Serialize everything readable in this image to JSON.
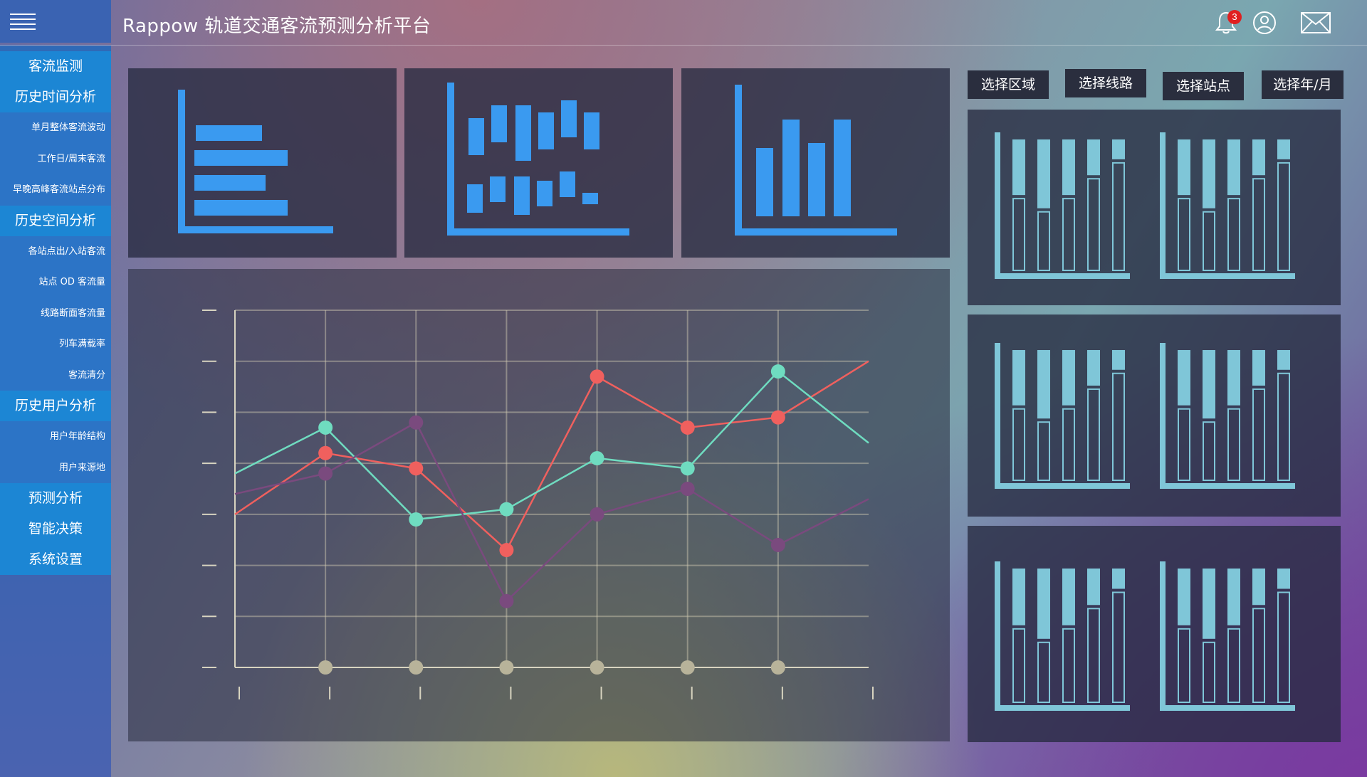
{
  "app": {
    "title": "Rappow 轨道交通客流预测分析平台",
    "notification_count": "3"
  },
  "icons": {
    "menu": "hamburger-menu-icon",
    "bell": "bell-icon",
    "user": "user-icon",
    "mail": "mail-icon"
  },
  "sidebar": {
    "items": [
      {
        "label": "客流监测",
        "level": "main"
      },
      {
        "label": "历史时间分析",
        "level": "main"
      },
      {
        "label": "单月整体客流波动",
        "level": "sub"
      },
      {
        "label": "工作日/周末客流",
        "level": "sub"
      },
      {
        "label": "早晚高峰客流站点分布",
        "level": "sub"
      },
      {
        "label": "历史空间分析",
        "level": "main"
      },
      {
        "label": "各站点出/入站客流",
        "level": "sub"
      },
      {
        "label": "站点 OD 客流量",
        "level": "sub"
      },
      {
        "label": "线路断面客流量",
        "level": "sub"
      },
      {
        "label": "列车满载率",
        "level": "sub"
      },
      {
        "label": "客流清分",
        "level": "sub"
      },
      {
        "label": "历史用户分析",
        "level": "main"
      },
      {
        "label": "用户年龄结构",
        "level": "sub"
      },
      {
        "label": "用户来源地",
        "level": "sub"
      },
      {
        "label": "预测分析",
        "level": "main"
      },
      {
        "label": "智能决策",
        "level": "main"
      },
      {
        "label": "系统设置",
        "level": "main"
      }
    ]
  },
  "filters": {
    "region": "选择区域",
    "line": "选择线路",
    "station": "选择站点",
    "year_month": "选择年/月"
  },
  "colors": {
    "accent_blue": "#3a9af0",
    "side_bar": "#7fc6d8",
    "series_red": "#f0605e",
    "series_teal": "#6fdcc0",
    "series_purple": "#7a4a7e",
    "axis_dot": "#b8b39a"
  },
  "chart_data": {
    "type": "line",
    "x": [
      0,
      1,
      2,
      3,
      4,
      5,
      6,
      7
    ],
    "ylim": [
      0,
      7
    ],
    "grid": true,
    "series": [
      {
        "color": "#f0605e",
        "values": [
          3.0,
          4.2,
          3.9,
          2.3,
          5.7,
          4.7,
          4.9,
          6.0
        ]
      },
      {
        "color": "#6fdcc0",
        "values": [
          3.8,
          4.7,
          2.9,
          3.1,
          4.1,
          3.9,
          5.8,
          4.4
        ]
      },
      {
        "color": "#7a4a7e",
        "values": [
          3.4,
          3.8,
          4.8,
          1.3,
          3.0,
          3.5,
          2.4,
          3.3
        ]
      }
    ]
  }
}
